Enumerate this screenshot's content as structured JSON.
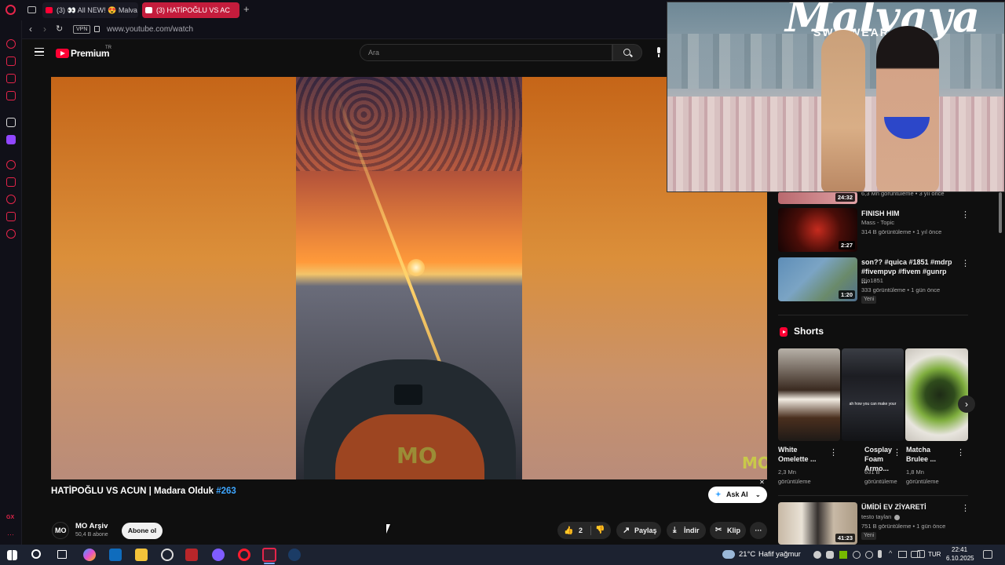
{
  "browser": {
    "tabs": [
      {
        "label": "(3) 👀 All NEW! 😍 Malva"
      },
      {
        "label": "(3) HATİPOĞLU VS AC"
      }
    ],
    "url": "www.youtube.com/watch",
    "vpn_badge": "VPN",
    "gx_label": "GX"
  },
  "youtube": {
    "logo_text": "Premium",
    "logo_region": "TR",
    "search_placeholder": "Ara",
    "video": {
      "title": "HATİPOĞLU VS ACUN | Madara Olduk",
      "hashtag": "#263",
      "watermark": "MO"
    },
    "channel": {
      "avatar_text": "MO",
      "name": "MO Arşiv",
      "subscribers": "50,4 B abone",
      "subscribe_label": "Abone ol"
    },
    "actions": {
      "likes": "2",
      "share": "Paylaş",
      "download": "İndir",
      "clip": "Klip",
      "ask_ai": "Ask AI"
    },
    "pip": {
      "brand": "Malvaya",
      "sub": "SWIMWEAR"
    },
    "recommendations": [
      {
        "duration": "24:32",
        "meta": "6,3 Mn görüntüleme • 3 yıl önce"
      },
      {
        "title": "FINISH HIM",
        "channel": "Mass - Topic",
        "meta": "314 B görüntüleme • 1 yıl önce",
        "duration": "2:27"
      },
      {
        "title": "son?? #quica #1851 #mdrp #fivempvp #fivem #gunrp ...",
        "channel": "Rio1851",
        "meta": "333 görüntüleme • 1 gün önce",
        "badge": "Yeni",
        "duration": "1:20"
      }
    ],
    "shorts": {
      "heading": "Shorts",
      "items": [
        {
          "title_l1": "White",
          "title_l2": "Omelette ...",
          "views_l1": "2,3 Mn",
          "views_l2": "görüntüleme"
        },
        {
          "title_l1": "Cosplay",
          "title_l2": "Foam Armo...",
          "views_l1": "631 B",
          "views_l2": "görüntüleme",
          "overlay_text": "ah how you can make your"
        },
        {
          "title_l1": "Matcha",
          "title_l2": "Brulee ...",
          "views_l1": "1,8 Mn",
          "views_l2": "görüntüleme"
        }
      ]
    },
    "bottom_recommendation": {
      "title": "ÜMİDİ EV ZİYARETİ",
      "channel": "testo taylan",
      "meta": "751 B görüntüleme • 1 gün önce",
      "badge": "Yeni",
      "duration": "41:23"
    }
  },
  "taskbar": {
    "weather_temp": "21°C",
    "weather_desc": "Hafif yağmur",
    "lang": "TUR",
    "time": "22:41",
    "date": "6.10.2025"
  }
}
